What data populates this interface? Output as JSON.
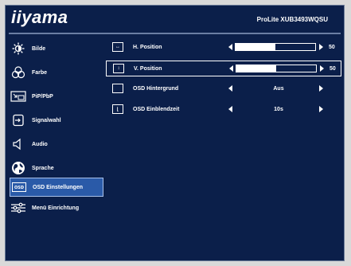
{
  "header": {
    "logo": "iiyama",
    "model": "ProLite XUB3493WQSU"
  },
  "sidebar": {
    "items": [
      {
        "label": "Bilde",
        "icon": "brightness-icon"
      },
      {
        "label": "Farbe",
        "icon": "color-icon"
      },
      {
        "label": "PiP/PbP",
        "icon": "pip-icon"
      },
      {
        "label": "Signalwahl",
        "icon": "input-icon"
      },
      {
        "label": "Audio",
        "icon": "speaker-icon"
      },
      {
        "label": "Sprache",
        "icon": "globe-icon"
      },
      {
        "label": "OSD Einstellungen",
        "icon": "osd-icon",
        "active": true
      },
      {
        "label": "Menü Einrichtung",
        "icon": "sliders-icon"
      }
    ]
  },
  "settings": [
    {
      "label": "H. Position",
      "icon": "h-position-icon",
      "type": "slider",
      "value": "50",
      "level": 0.5,
      "selected": false
    },
    {
      "label": "V. Position",
      "icon": "v-position-icon",
      "type": "slider",
      "value": "50",
      "level": 0.5,
      "selected": true
    },
    {
      "label": "OSD Hintergrund",
      "icon": "background-icon",
      "type": "option",
      "value": "Aus",
      "selected": false
    },
    {
      "label": "OSD Einblendzeit",
      "icon": "timer-icon",
      "type": "option",
      "value": "10s",
      "selected": false
    }
  ],
  "colors": {
    "background": "#0b1f4a",
    "active": "#2a5aa8",
    "text": "#ffffff"
  }
}
